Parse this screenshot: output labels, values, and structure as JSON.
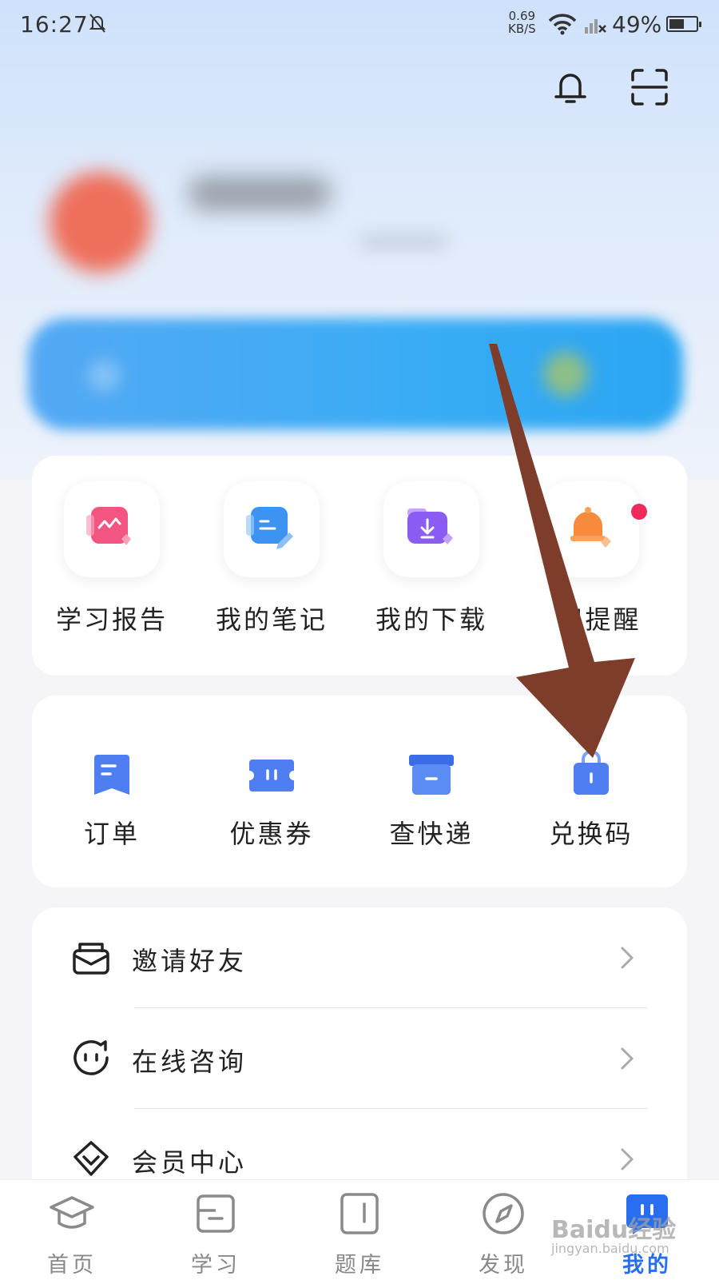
{
  "status_bar": {
    "time": "16:27",
    "net_speed_value": "0.69",
    "net_speed_unit": "KB/S",
    "battery_percent": "49%",
    "battery_level": 0.49
  },
  "quick_tools": [
    {
      "label": "学习报告",
      "icon": "report-icon",
      "color": "#f0507c"
    },
    {
      "label": "我的笔记",
      "icon": "note-icon",
      "color": "#3b8ef0"
    },
    {
      "label": "我的下载",
      "icon": "download-icon",
      "color": "#8a5cf0"
    },
    {
      "label": "习提醒",
      "icon": "alarm-bell-icon",
      "color": "#f68a3a",
      "badge": true
    }
  ],
  "services": [
    {
      "label": "订单",
      "icon": "order-icon"
    },
    {
      "label": "优惠券",
      "icon": "coupon-icon"
    },
    {
      "label": "查快递",
      "icon": "express-box-icon"
    },
    {
      "label": "兑换码",
      "icon": "redeem-code-icon"
    }
  ],
  "menu": [
    {
      "label": "邀请好友",
      "icon": "invite-mail-icon"
    },
    {
      "label": "在线咨询",
      "icon": "chat-face-icon"
    },
    {
      "label": "会员中心",
      "icon": "vip-diamond-icon"
    }
  ],
  "tabs": [
    {
      "label": "首页",
      "icon": "graduation-cap-icon",
      "active": false
    },
    {
      "label": "学习",
      "icon": "book-icon",
      "active": false
    },
    {
      "label": "题库",
      "icon": "question-bank-icon",
      "active": false
    },
    {
      "label": "发现",
      "icon": "compass-icon",
      "active": false
    },
    {
      "label": "我的",
      "icon": "profile-bubble-icon",
      "active": true
    }
  ],
  "watermark": {
    "brand": "Baidu经验",
    "url": "jingyan.baidu.com"
  },
  "colors": {
    "accent": "#2a6ef0",
    "arrow": "#7e3d2a"
  }
}
